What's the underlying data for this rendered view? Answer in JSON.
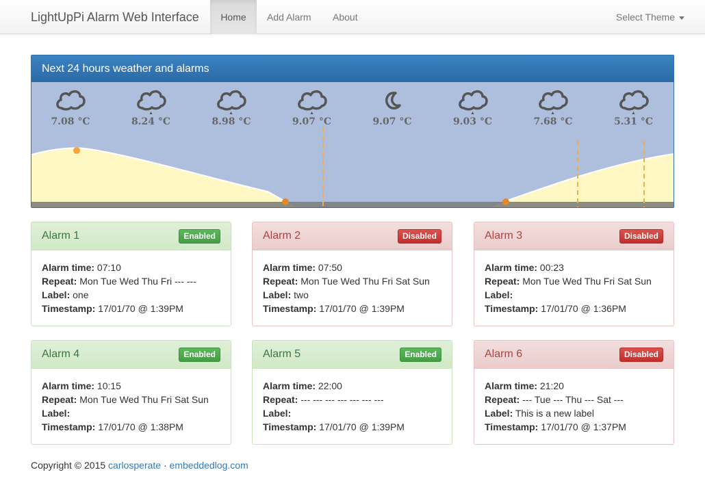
{
  "navbar": {
    "brand": "LightUpPi Alarm Web Interface",
    "links": [
      {
        "label": "Home",
        "active": true
      },
      {
        "label": "Add Alarm",
        "active": false
      },
      {
        "label": "About",
        "active": false
      }
    ],
    "theme_label": "Select Theme"
  },
  "weather": {
    "title": "Next 24 hours weather and alarms",
    "slots": [
      {
        "icon": "cloud-icon",
        "temp": "7.08 °C"
      },
      {
        "icon": "cloud-rain-icon",
        "temp": "8.24 °C"
      },
      {
        "icon": "cloud-rain-icon",
        "temp": "8.98 °C"
      },
      {
        "icon": "cloud-rain-icon",
        "temp": "9.07 °C"
      },
      {
        "icon": "moon-icon",
        "temp": "9.07 °C"
      },
      {
        "icon": "cloud-rain-icon",
        "temp": "9.03 °C"
      },
      {
        "icon": "cloud-rain-icon",
        "temp": "7.68 °C"
      },
      {
        "icon": "cloud-rain-icon",
        "temp": "5.31 °C"
      }
    ],
    "colors": {
      "sky": "#aebfdd",
      "daylight": "#fff8c4",
      "ground": "#8c8c82",
      "alarm_line": "#f0ad4e",
      "sun": "#f0a030"
    }
  },
  "alarms": [
    {
      "title": "Alarm 1",
      "status": "Enabled",
      "enabled": true,
      "time_label": "Alarm time:",
      "time": "07:10",
      "repeat_label": "Repeat:",
      "repeat": "Mon Tue Wed Thu Fri --- ---",
      "label_label": "Label:",
      "label": "one",
      "ts_label": "Timestamp:",
      "timestamp": "17/01/70 @ 1:39PM"
    },
    {
      "title": "Alarm 2",
      "status": "Disabled",
      "enabled": false,
      "time_label": "Alarm time:",
      "time": "07:50",
      "repeat_label": "Repeat:",
      "repeat": "Mon Tue Wed Thu Fri Sat Sun",
      "label_label": "Label:",
      "label": "two",
      "ts_label": "Timestamp:",
      "timestamp": "17/01/70 @ 1:39PM"
    },
    {
      "title": "Alarm 3",
      "status": "Disabled",
      "enabled": false,
      "time_label": "Alarm time:",
      "time": "00:23",
      "repeat_label": "Repeat:",
      "repeat": "Mon Tue Wed Thu Fri Sat Sun",
      "label_label": "Label:",
      "label": "",
      "ts_label": "Timestamp:",
      "timestamp": "17/01/70 @ 1:36PM"
    },
    {
      "title": "Alarm 4",
      "status": "Enabled",
      "enabled": true,
      "time_label": "Alarm time:",
      "time": "10:15",
      "repeat_label": "Repeat:",
      "repeat": "Mon Tue Wed Thu Fri Sat Sun",
      "label_label": "Label:",
      "label": "",
      "ts_label": "Timestamp:",
      "timestamp": "17/01/70 @ 1:38PM"
    },
    {
      "title": "Alarm 5",
      "status": "Enabled",
      "enabled": true,
      "time_label": "Alarm time:",
      "time": "22:00",
      "repeat_label": "Repeat:",
      "repeat": "--- --- --- --- --- --- ---",
      "label_label": "Label:",
      "label": "",
      "ts_label": "Timestamp:",
      "timestamp": "17/01/70 @ 1:39PM"
    },
    {
      "title": "Alarm 6",
      "status": "Disabled",
      "enabled": false,
      "time_label": "Alarm time:",
      "time": "21:20",
      "repeat_label": "Repeat:",
      "repeat": "--- Tue --- Thu --- Sat ---",
      "label_label": "Label:",
      "label": "This is a new label",
      "ts_label": "Timestamp:",
      "timestamp": "17/01/70 @ 1:37PM"
    }
  ],
  "footer": {
    "copyright": "Copyright © 2015",
    "author": "carlosperate",
    "separator": "·",
    "site": "embeddedlog.com"
  }
}
